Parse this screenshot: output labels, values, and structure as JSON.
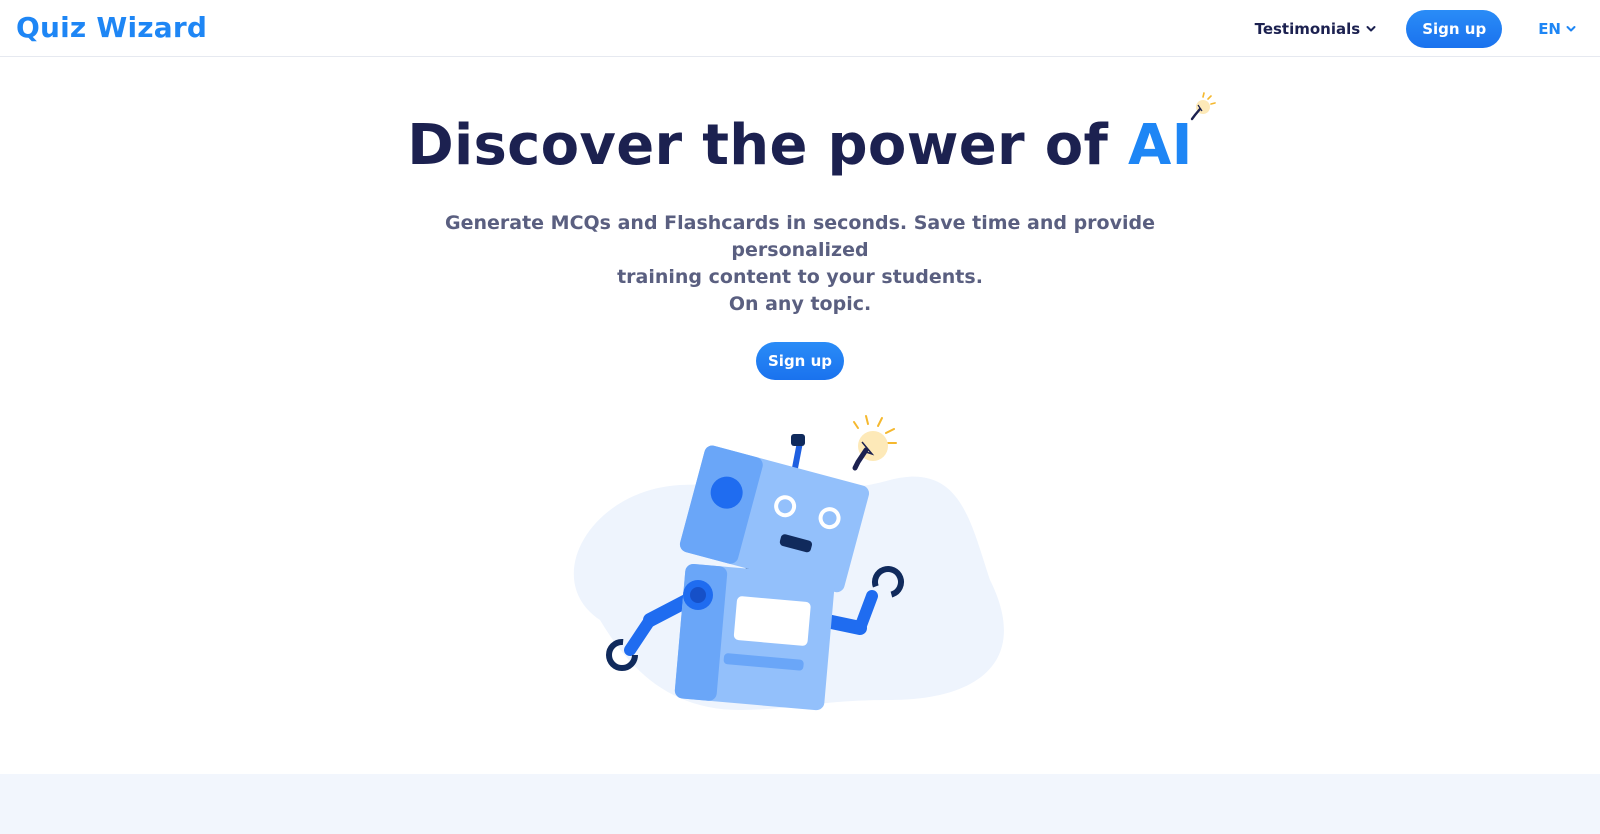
{
  "navbar": {
    "logo": "Quiz Wizard",
    "testimonials_label": "Testimonials",
    "signup_label": "Sign up",
    "language_label": "EN"
  },
  "hero": {
    "title_main": "Discover the power of ",
    "title_accent": "AI",
    "subtitle_lines": [
      "Generate MCQs and Flashcards in seconds. Save time and provide personalized",
      "training content to your students.",
      "On any topic."
    ],
    "cta_label": "Sign up"
  },
  "icons": {
    "chevron": "chevron-down-icon",
    "bulb": "lightbulb-icon",
    "robot": "robot-illustration"
  },
  "colors": {
    "brand": "#1e86f5",
    "heading": "#1c2150",
    "subtitle": "#5a5f80",
    "band": "#f2f6fd"
  }
}
